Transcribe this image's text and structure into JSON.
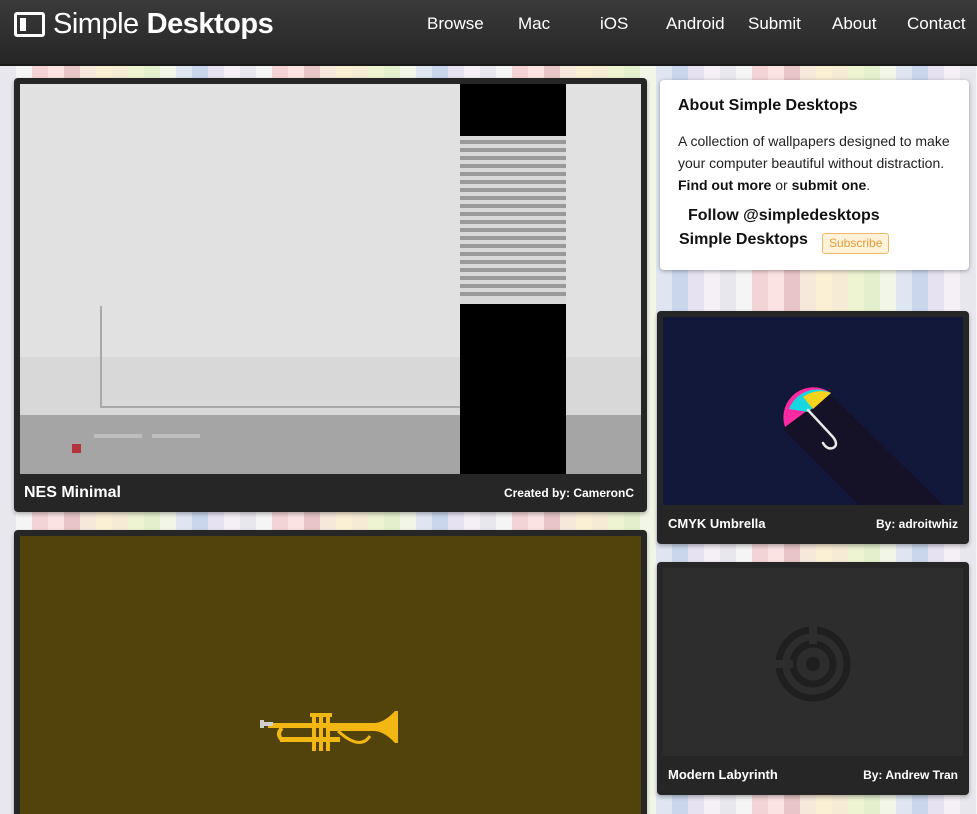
{
  "header": {
    "logo_light": "Simple",
    "logo_bold": "Desktops",
    "nav": [
      "Browse",
      "Mac",
      "iOS",
      "Android",
      "Submit",
      "About",
      "Contact"
    ]
  },
  "sidebar": {
    "about_title": "About Simple Desktops",
    "about_text_1": "A collection of wallpapers designed to make your computer beautiful without distraction. ",
    "find_out_more": "Find out more",
    "or": " or ",
    "submit_one": "submit one",
    "period": ".",
    "follow": "Follow @simpledesktops",
    "sd_label": "Simple Desktops",
    "subscribe": "Subscribe"
  },
  "wallpapers": [
    {
      "title": "NES Minimal",
      "credit": "Created by: CameronC"
    },
    {
      "title": "",
      "credit": ""
    },
    {
      "title": "CMYK Umbrella",
      "credit": "By: adroitwhiz"
    },
    {
      "title": "Modern Labyrinth",
      "credit": "By: Andrew Tran"
    }
  ],
  "colors": {
    "header_bg": "#2e2e2e",
    "card_bg": "#262626",
    "subscribe_bg": "#fff2d9",
    "subscribe_text": "#e69b3a",
    "umbrella_bg": "#12183a",
    "trumpet_bg": "#52420b",
    "labyrinth_bg": "#2d2d2d"
  },
  "icons": [
    "desktop-logo-icon",
    "umbrella-icon",
    "trumpet-icon",
    "labyrinth-icon"
  ]
}
